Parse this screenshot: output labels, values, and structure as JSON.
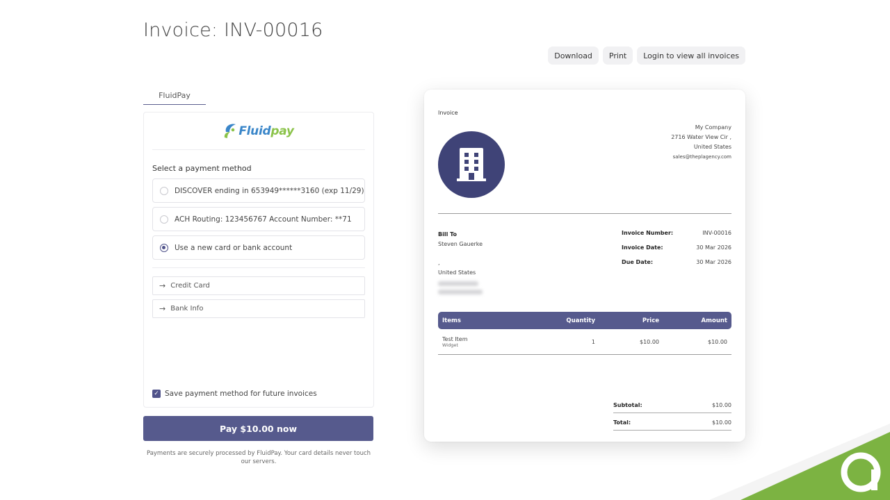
{
  "page": {
    "title": "Invoice: INV-00016"
  },
  "actions": {
    "download": "Download",
    "print": "Print",
    "login": "Login to view all invoices"
  },
  "payment": {
    "tab": "FluidPay",
    "logo_text_a": "Fluid",
    "logo_text_b": "pay",
    "select_label": "Select a payment method",
    "methods": [
      {
        "label": "DISCOVER ending in 653949******3160 (exp 11/29)",
        "selected": false
      },
      {
        "label": "ACH Routing: 123456767 Account Number: **71",
        "selected": false
      },
      {
        "label": "Use a new card or bank account",
        "selected": true
      }
    ],
    "accordions": [
      {
        "label": "Credit Card"
      },
      {
        "label": "Bank Info"
      }
    ],
    "save_label": "Save payment method for future invoices",
    "save_checked": true,
    "pay_button": "Pay $10.00 now",
    "secure_note": "Payments are securely processed by FluidPay. Your card details never touch our servers."
  },
  "invoice": {
    "label": "Invoice",
    "company": {
      "name": "My Company",
      "address": "2716 Water View Cir ,",
      "country": "United States",
      "email": "sales@theplagency.com"
    },
    "bill_to": {
      "heading": "Bill To",
      "name": "Steven Gauerke",
      "line": ",",
      "country": "United States"
    },
    "meta": [
      {
        "key": "Invoice Number:",
        "value": "INV-00016"
      },
      {
        "key": "Invoice Date:",
        "value": "30 Mar 2026"
      },
      {
        "key": "Due Date:",
        "value": "30 Mar 2026"
      }
    ],
    "columns": {
      "item": "Items",
      "quantity": "Quantity",
      "price": "Price",
      "amount": "Amount"
    },
    "rows": [
      {
        "item": "Test Item",
        "sub": "Widget",
        "quantity": "1",
        "price": "$10.00",
        "amount": "$10.00"
      }
    ],
    "subtotal_label": "Subtotal:",
    "subtotal": "$10.00",
    "total_label": "Total:",
    "total": "$10.00"
  },
  "colors": {
    "accent": "#565a8d",
    "logo_blue": "#3a86c9",
    "logo_green": "#8bc34a",
    "corner_green": "#7cb342"
  },
  "icons": {
    "building": "building-icon",
    "arrow": "arrow-right-icon",
    "check": "checkmark-icon",
    "brand": "brand-logo-icon"
  }
}
